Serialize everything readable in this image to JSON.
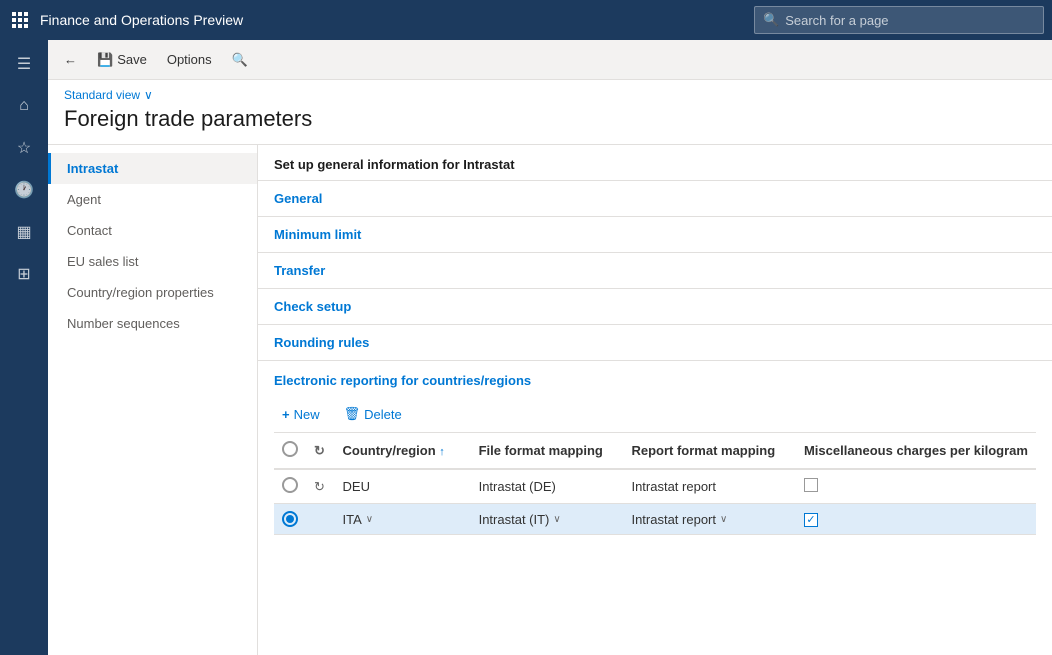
{
  "app": {
    "title": "Finance and Operations Preview",
    "search_placeholder": "Search for a page"
  },
  "toolbar": {
    "back_label": "",
    "save_label": "Save",
    "options_label": "Options"
  },
  "page": {
    "view_label": "Standard view",
    "title": "Foreign trade parameters"
  },
  "left_nav": {
    "items": [
      {
        "id": "intrastat",
        "label": "Intrastat",
        "active": true
      },
      {
        "id": "agent",
        "label": "Agent",
        "active": false
      },
      {
        "id": "contact",
        "label": "Contact",
        "active": false
      },
      {
        "id": "eu-sales-list",
        "label": "EU sales list",
        "active": false
      },
      {
        "id": "country-region",
        "label": "Country/region properties",
        "active": false
      },
      {
        "id": "number-sequences",
        "label": "Number sequences",
        "active": false
      }
    ]
  },
  "panel": {
    "subtitle": "Set up general information for Intrastat",
    "sections": [
      {
        "id": "general",
        "label": "General"
      },
      {
        "id": "minimum-limit",
        "label": "Minimum limit"
      },
      {
        "id": "transfer",
        "label": "Transfer"
      },
      {
        "id": "check-setup",
        "label": "Check setup"
      },
      {
        "id": "rounding-rules",
        "label": "Rounding rules"
      }
    ],
    "table_section": {
      "title": "Electronic reporting for countries/regions",
      "toolbar": {
        "new_label": "New",
        "delete_label": "Delete"
      },
      "columns": [
        {
          "id": "select",
          "label": ""
        },
        {
          "id": "refresh",
          "label": ""
        },
        {
          "id": "country",
          "label": "Country/region"
        },
        {
          "id": "sort",
          "label": ""
        },
        {
          "id": "file-format",
          "label": "File format mapping"
        },
        {
          "id": "report-format",
          "label": "Report format mapping"
        },
        {
          "id": "misc-charges",
          "label": "Miscellaneous charges per kilogram"
        }
      ],
      "rows": [
        {
          "id": "row-1",
          "selected": false,
          "country": "DEU",
          "file_format": "Intrastat (DE)",
          "report_format": "Intrastat report",
          "misc_checked": false
        },
        {
          "id": "row-2",
          "selected": true,
          "country": "ITA",
          "file_format": "Intrastat (IT)",
          "report_format": "Intrastat report",
          "misc_checked": true
        }
      ]
    }
  },
  "icons": {
    "grid": "⊞",
    "home": "⌂",
    "star": "☆",
    "clock": "🕐",
    "pin": "📌",
    "list": "☰",
    "chart": "📊",
    "back": "←",
    "save": "💾",
    "search_small": "🔍",
    "add": "+",
    "trash": "🗑",
    "chevron_down": "∨",
    "sort_up": "↑"
  }
}
